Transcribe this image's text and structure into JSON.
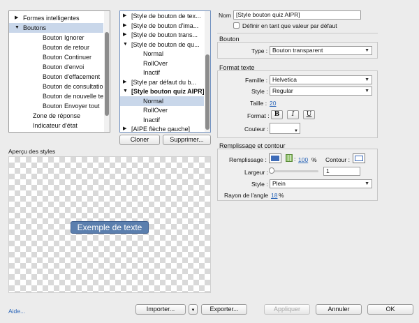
{
  "left_tree": {
    "items": [
      {
        "label": "Formes intelligentes",
        "arrow": "▶",
        "selected": false
      },
      {
        "label": "Boutons",
        "arrow": "▼",
        "selected": true
      },
      {
        "label": "Bouton Ignorer",
        "arrow": "",
        "selected": false
      },
      {
        "label": "Bouton de retour",
        "arrow": "",
        "selected": false
      },
      {
        "label": "Bouton Continuer",
        "arrow": "",
        "selected": false
      },
      {
        "label": "Bouton d'envoi",
        "arrow": "",
        "selected": false
      },
      {
        "label": "Bouton d'effacement",
        "arrow": "",
        "selected": false
      },
      {
        "label": "Bouton de consultation",
        "arrow": "",
        "selected": false
      },
      {
        "label": "Bouton de nouvelle tentative",
        "arrow": "",
        "selected": false
      },
      {
        "label": "Bouton Envoyer tout",
        "arrow": "",
        "selected": false
      },
      {
        "label": "Zone de réponse",
        "arrow": "",
        "selected": false
      },
      {
        "label": "Indicateur d'état",
        "arrow": "",
        "selected": false
      }
    ]
  },
  "style_tree": {
    "items": [
      {
        "label": "[Style de bouton de tex...",
        "arrow": "▶",
        "selected": false,
        "bold": false
      },
      {
        "label": "[Style de bouton d'ima...",
        "arrow": "▶",
        "selected": false,
        "bold": false
      },
      {
        "label": "[Style de bouton trans...",
        "arrow": "▶",
        "selected": false,
        "bold": false
      },
      {
        "label": "[Style de bouton de qu...",
        "arrow": "▼",
        "selected": false,
        "bold": false
      },
      {
        "label": "Normal",
        "arrow": "",
        "selected": false,
        "bold": false
      },
      {
        "label": "RollOver",
        "arrow": "",
        "selected": false,
        "bold": false
      },
      {
        "label": "Inactif",
        "arrow": "",
        "selected": false,
        "bold": false
      },
      {
        "label": "[Style par défaut du b...",
        "arrow": "▶",
        "selected": false,
        "bold": false
      },
      {
        "label": "[Style bouton quiz AIPR]",
        "arrow": "▼",
        "selected": false,
        "bold": true
      },
      {
        "label": "Normal",
        "arrow": "",
        "selected": true,
        "bold": false
      },
      {
        "label": "RollOver",
        "arrow": "",
        "selected": false,
        "bold": false
      },
      {
        "label": "Inactif",
        "arrow": "",
        "selected": false,
        "bold": false
      },
      {
        "label": "[AIPE flèche gauche]",
        "arrow": "▶",
        "selected": false,
        "bold": false
      }
    ]
  },
  "buttons": {
    "clone": "Cloner",
    "delete": "Supprimer...",
    "help": "Aide...",
    "import": "Importer...",
    "export": "Exporter...",
    "apply": "Appliquer",
    "cancel": "Annuler",
    "ok": "OK"
  },
  "preview": {
    "title": "Aperçu des styles",
    "sample_text": "Exemple de texte"
  },
  "name": {
    "label": "Nom",
    "value": "[Style bouton quiz AIPR]",
    "default_checkbox": "Définir en tant que valeur par défaut"
  },
  "bouton": {
    "title": "Bouton",
    "type_label": "Type :",
    "type_value": "Bouton transparent"
  },
  "format_texte": {
    "title": "Format texte",
    "family_label": "Famille :",
    "family_value": "Helvetica",
    "style_label": "Style :",
    "style_value": "Regular",
    "size_label": "Taille :",
    "size_value": "20",
    "format_label": "Format :",
    "bold": "B",
    "italic": "I",
    "underline": "U",
    "color_label": "Couleur :"
  },
  "remplissage": {
    "title": "Remplissage et contour",
    "fill_label": "Remplissage :",
    "fill_opacity": "100",
    "percent": "%",
    "stroke_label": "Contour :",
    "width_label": "Largeur :",
    "width_value": "1",
    "style_label": "Style :",
    "style_value": "Plein",
    "radius_label": "Rayon de l'angle",
    "radius_value": "18",
    "radius_unit": "%"
  },
  "colors": {
    "selection": "#c9d7ea",
    "accent_blue": "#2b66b8",
    "button_fill": "#5b7fae"
  }
}
